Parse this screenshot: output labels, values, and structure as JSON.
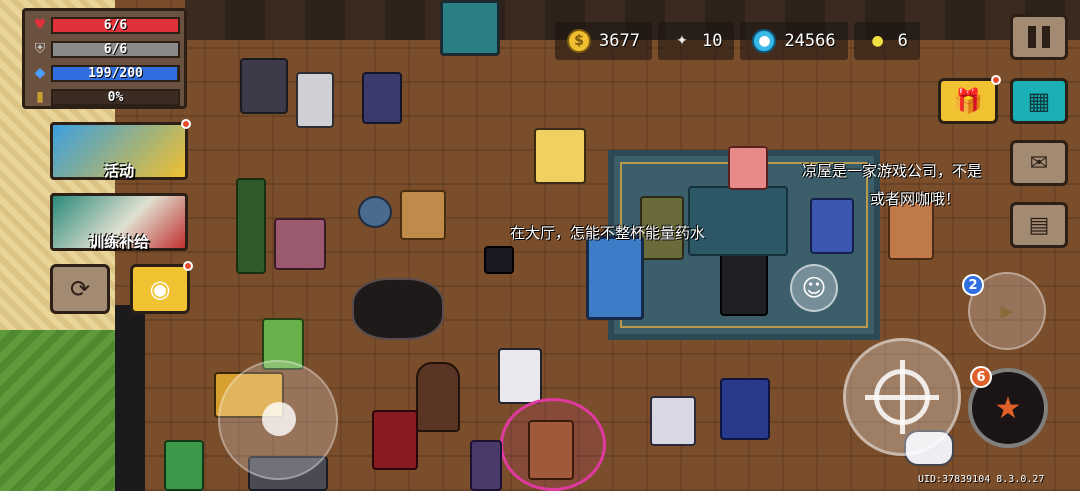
{
  "hud": {
    "hp": {
      "label": "6/6",
      "fill": 1.0,
      "color": "#e0303a"
    },
    "armor": {
      "label": "6/6",
      "fill": 1.0,
      "color": "#8a8a8a"
    },
    "energy": {
      "label": "199/200",
      "fill": 0.995,
      "color": "#2f6fe0"
    },
    "charge": {
      "label": "0%",
      "fill": 0.0,
      "color": "#caa033"
    }
  },
  "resources": {
    "gold": "3677",
    "feather": "10",
    "gems": "24566",
    "seeds": "6"
  },
  "events": {
    "activity_label": "活动",
    "training_label": "训练补给"
  },
  "speech": {
    "hall": "在大厅，怎能不整杯能量药水",
    "npc_line1": "凉屋是一家游戏公司，不是",
    "npc_line2": "或者网咖哦！"
  },
  "badges": {
    "weapon_count": "2",
    "skill_count": "6"
  },
  "footer": {
    "uid": "UID:37839104  8.3.0.27"
  },
  "icons": {
    "hp": "heart-icon",
    "armor": "shield-icon",
    "energy": "diamond-icon",
    "charge": "potion-icon",
    "gold": "coin-icon",
    "feather": "feather-icon",
    "gems": "gem-icon",
    "seeds": "seed-icon"
  }
}
